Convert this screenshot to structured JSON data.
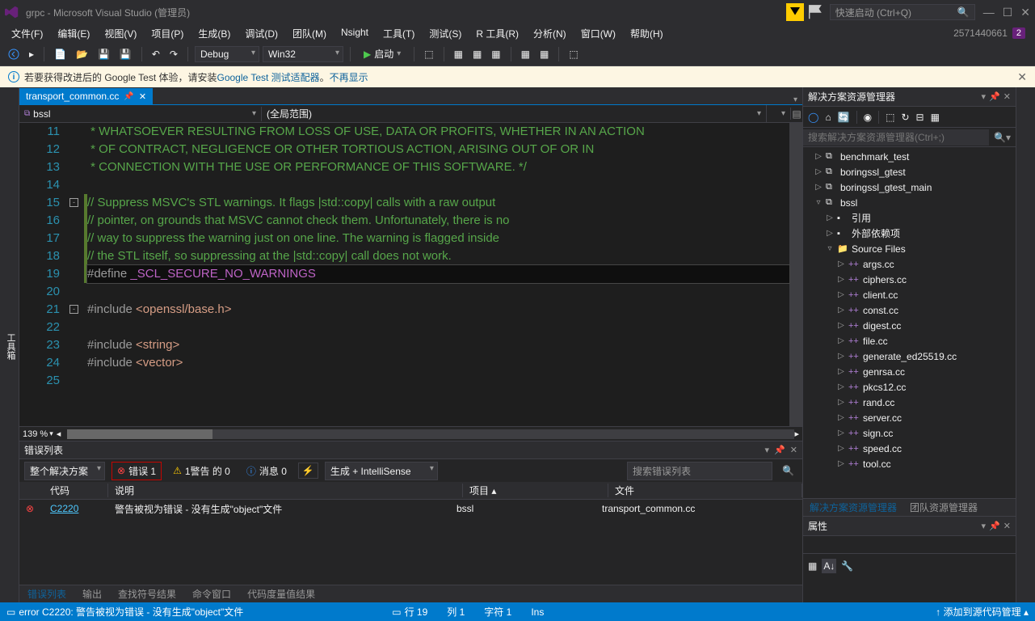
{
  "titlebar": {
    "title": "grpc - Microsoft Visual Studio (管理员)",
    "quick_launch_placeholder": "快速启动 (Ctrl+Q)",
    "notif_count": "2571440661",
    "badge": "2"
  },
  "menubar": [
    "文件(F)",
    "编辑(E)",
    "视图(V)",
    "项目(P)",
    "生成(B)",
    "调试(D)",
    "团队(M)",
    "Nsight",
    "工具(T)",
    "测试(S)",
    "R 工具(R)",
    "分析(N)",
    "窗口(W)",
    "帮助(H)"
  ],
  "toolbar": {
    "config": "Debug",
    "platform": "Win32",
    "start_label": "启动"
  },
  "infobar": {
    "prefix": "若要获得改进后的 Google Test 体验，请安装",
    "link1": "Google Test 测试适配器",
    "suffix": "。",
    "link2": "不再显示"
  },
  "doc_tab": "transport_common.cc",
  "nav": {
    "left_icon": "bssl",
    "scope": "(全局范围)"
  },
  "code": {
    "lines": [
      {
        "n": 11,
        "cls": "comment",
        "t": " * WHATSOEVER RESULTING FROM LOSS OF USE, DATA OR PROFITS, WHETHER IN AN ACTION"
      },
      {
        "n": 12,
        "cls": "comment",
        "t": " * OF CONTRACT, NEGLIGENCE OR OTHER TORTIOUS ACTION, ARISING OUT OF OR IN"
      },
      {
        "n": 13,
        "cls": "comment",
        "t": " * CONNECTION WITH THE USE OR PERFORMANCE OF THIS SOFTWARE. */"
      },
      {
        "n": 14,
        "cls": "",
        "t": ""
      },
      {
        "n": 15,
        "cls": "comment",
        "t": "// Suppress MSVC's STL warnings. It flags |std::copy| calls with a raw output"
      },
      {
        "n": 16,
        "cls": "comment",
        "t": "// pointer, on grounds that MSVC cannot check them. Unfortunately, there is no"
      },
      {
        "n": 17,
        "cls": "comment",
        "t": "// way to suppress the warning just on one line. The warning is flagged inside"
      },
      {
        "n": 18,
        "cls": "comment",
        "t": "// the STL itself, so suppressing at the |std::copy| call does not work."
      },
      {
        "n": 19,
        "cls": "current",
        "html": "<span class='preproc'>#define </span><span class='macro'>_SCL_SECURE_NO_WARNINGS</span>"
      },
      {
        "n": 20,
        "cls": "",
        "t": ""
      },
      {
        "n": 21,
        "cls": "",
        "html": "<span class='preproc'>#include </span><span class='string'>&lt;openssl/base.h&gt;</span>"
      },
      {
        "n": 22,
        "cls": "",
        "t": ""
      },
      {
        "n": 23,
        "cls": "",
        "html": "<span class='preproc'>#include </span><span class='string'>&lt;string&gt;</span>"
      },
      {
        "n": 24,
        "cls": "",
        "html": "<span class='preproc'>#include </span><span class='string'>&lt;vector&gt;</span>"
      },
      {
        "n": 25,
        "cls": "",
        "t": ""
      }
    ],
    "zoom": "139 %"
  },
  "error_list": {
    "title": "错误列表",
    "scope": "整个解决方案",
    "errors_label": "错误 1",
    "warnings_label": "1警告 的 0",
    "messages_label": "消息 0",
    "source": "生成 + IntelliSense",
    "search_placeholder": "搜索错误列表",
    "cols": {
      "code": "代码",
      "desc": "说明",
      "project": "项目",
      "file": "文件"
    },
    "row": {
      "code": "C2220",
      "desc": "警告被视为错误 - 没有生成\"object\"文件",
      "project": "bssl",
      "file": "transport_common.cc"
    }
  },
  "bottom_tabs": [
    "错误列表",
    "输出",
    "查找符号结果",
    "命令窗口",
    "代码度量值结果"
  ],
  "solution_explorer": {
    "title": "解决方案资源管理器",
    "search_placeholder": "搜索解决方案资源管理器(Ctrl+;)",
    "tree": [
      {
        "indent": 1,
        "arrow": "▷",
        "icon": "⧉",
        "label": "benchmark_test"
      },
      {
        "indent": 1,
        "arrow": "▷",
        "icon": "⧉",
        "label": "boringssl_gtest"
      },
      {
        "indent": 1,
        "arrow": "▷",
        "icon": "⧉",
        "label": "boringssl_gtest_main"
      },
      {
        "indent": 1,
        "arrow": "▿",
        "icon": "⧉",
        "label": "bssl"
      },
      {
        "indent": 2,
        "arrow": "▷",
        "icon": "▪",
        "label": "引用"
      },
      {
        "indent": 2,
        "arrow": "▷",
        "icon": "▪",
        "label": "外部依赖项"
      },
      {
        "indent": 2,
        "arrow": "▿",
        "icon": "📁",
        "label": "Source Files"
      },
      {
        "indent": 3,
        "arrow": "▷",
        "icon": "++",
        "label": "args.cc"
      },
      {
        "indent": 3,
        "arrow": "▷",
        "icon": "++",
        "label": "ciphers.cc"
      },
      {
        "indent": 3,
        "arrow": "▷",
        "icon": "++",
        "label": "client.cc"
      },
      {
        "indent": 3,
        "arrow": "▷",
        "icon": "++",
        "label": "const.cc"
      },
      {
        "indent": 3,
        "arrow": "▷",
        "icon": "++",
        "label": "digest.cc"
      },
      {
        "indent": 3,
        "arrow": "▷",
        "icon": "++",
        "label": "file.cc"
      },
      {
        "indent": 3,
        "arrow": "▷",
        "icon": "++",
        "label": "generate_ed25519.cc"
      },
      {
        "indent": 3,
        "arrow": "▷",
        "icon": "++",
        "label": "genrsa.cc"
      },
      {
        "indent": 3,
        "arrow": "▷",
        "icon": "++",
        "label": "pkcs12.cc"
      },
      {
        "indent": 3,
        "arrow": "▷",
        "icon": "++",
        "label": "rand.cc"
      },
      {
        "indent": 3,
        "arrow": "▷",
        "icon": "++",
        "label": "server.cc"
      },
      {
        "indent": 3,
        "arrow": "▷",
        "icon": "++",
        "label": "sign.cc"
      },
      {
        "indent": 3,
        "arrow": "▷",
        "icon": "++",
        "label": "speed.cc"
      },
      {
        "indent": 3,
        "arrow": "▷",
        "icon": "++",
        "label": "tool.cc"
      }
    ],
    "tabs": [
      "解决方案资源管理器",
      "团队资源管理器"
    ]
  },
  "properties": {
    "title": "属性"
  },
  "statusbar": {
    "error": "error C2220: 警告被视为错误 - 没有生成\"object\"文件",
    "line_label": "行 19",
    "col_label": "列 1",
    "char_label": "字符 1",
    "ins": "Ins",
    "source_control": "添加到源代码管理"
  }
}
